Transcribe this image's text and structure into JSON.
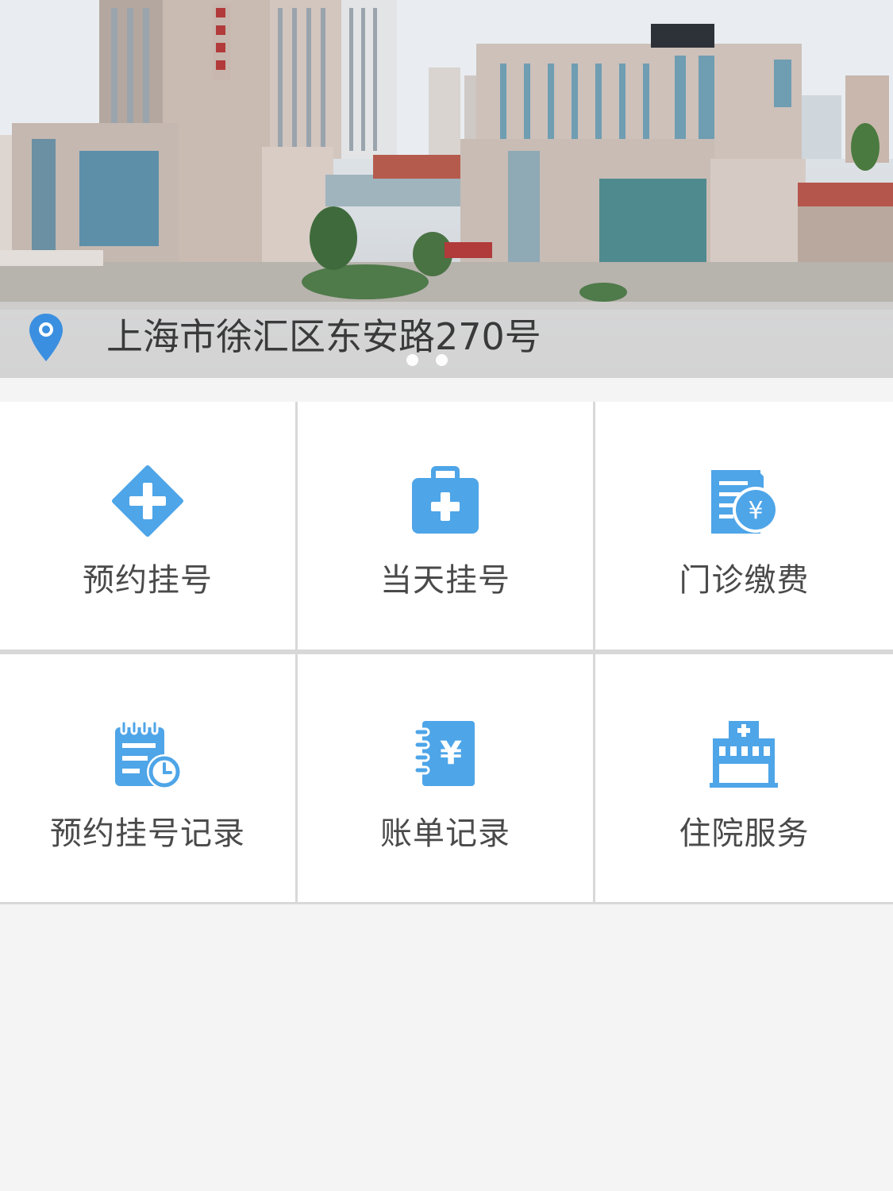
{
  "banner": {
    "address": "上海市徐汇区东安路270号",
    "pin_icon": "location-pin-icon",
    "carousel": {
      "count": 2,
      "active": 1
    }
  },
  "menu": {
    "items": [
      {
        "id": "appointment",
        "label": "预约挂号",
        "icon": "plus-diamond-icon"
      },
      {
        "id": "same-day",
        "label": "当天挂号",
        "icon": "medical-kit-icon"
      },
      {
        "id": "outpatient-pay",
        "label": "门诊缴费",
        "icon": "bill-yen-icon"
      },
      {
        "id": "appointment-records",
        "label": "预约挂号记录",
        "icon": "notepad-clock-icon"
      },
      {
        "id": "bill-records",
        "label": "账单记录",
        "icon": "notebook-yen-icon"
      },
      {
        "id": "inpatient",
        "label": "住院服务",
        "icon": "hospital-building-icon"
      }
    ]
  },
  "colors": {
    "icon_blue": "#4ea5e8",
    "label_text": "#4a4a4a",
    "page_background": "#f4f4f4",
    "divider": "#d8d8d8"
  }
}
